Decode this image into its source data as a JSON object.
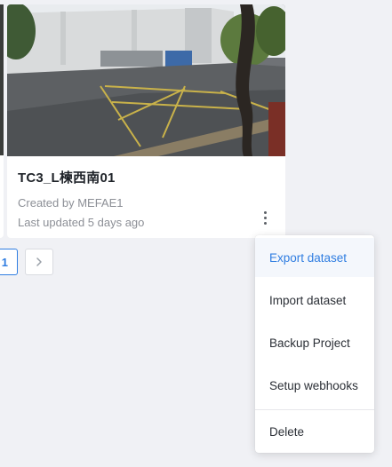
{
  "card": {
    "title": "TC3_L楝西南01",
    "created_by": "Created by MEFAE1",
    "last_updated": "Last updated 5 days ago"
  },
  "pagination": {
    "current_page": "1",
    "next_label": ">"
  },
  "context_menu": {
    "items": [
      {
        "label": "Export dataset",
        "active": true
      },
      {
        "label": "Import dataset"
      },
      {
        "label": "Backup Project"
      },
      {
        "label": "Setup webhooks"
      },
      {
        "label": "Delete"
      }
    ]
  },
  "colors": {
    "accent": "#2f7de1",
    "page_background": "#f0f1f5",
    "card_background": "#ffffff"
  },
  "icons": {
    "more": "more-vertical-icon",
    "next": "chevron-right-icon"
  }
}
